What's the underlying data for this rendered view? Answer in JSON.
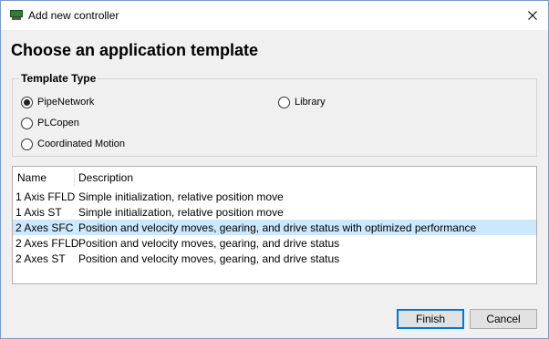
{
  "window": {
    "title": "Add new controller"
  },
  "heading": "Choose an application template",
  "template_type": {
    "legend": "Template Type",
    "options": [
      {
        "label": "PipeNetwork",
        "checked": true
      },
      {
        "label": "Library",
        "checked": false
      },
      {
        "label": "PLCopen",
        "checked": false
      },
      {
        "label": "Coordinated Motion",
        "checked": false
      }
    ]
  },
  "table": {
    "columns": [
      "Name",
      "Description"
    ],
    "rows": [
      {
        "name": "1 Axis FFLD",
        "description": "Simple initialization, relative position move"
      },
      {
        "name": "1 Axis ST",
        "description": "Simple initialization, relative position move"
      },
      {
        "name": "2 Axes SFC",
        "description": "Position and velocity moves, gearing, and drive status with optimized performance",
        "selected": true
      },
      {
        "name": "2 Axes FFLD",
        "description": "Position and velocity moves, gearing, and drive status"
      },
      {
        "name": "2 Axes ST",
        "description": "Position and velocity moves, gearing, and drive status"
      }
    ]
  },
  "buttons": {
    "finish": "Finish",
    "cancel": "Cancel"
  },
  "icons": {
    "app": "controller-icon",
    "close": "close-icon"
  },
  "colors": {
    "selection": "#cce8ff",
    "default_button_border": "#0078d7"
  }
}
